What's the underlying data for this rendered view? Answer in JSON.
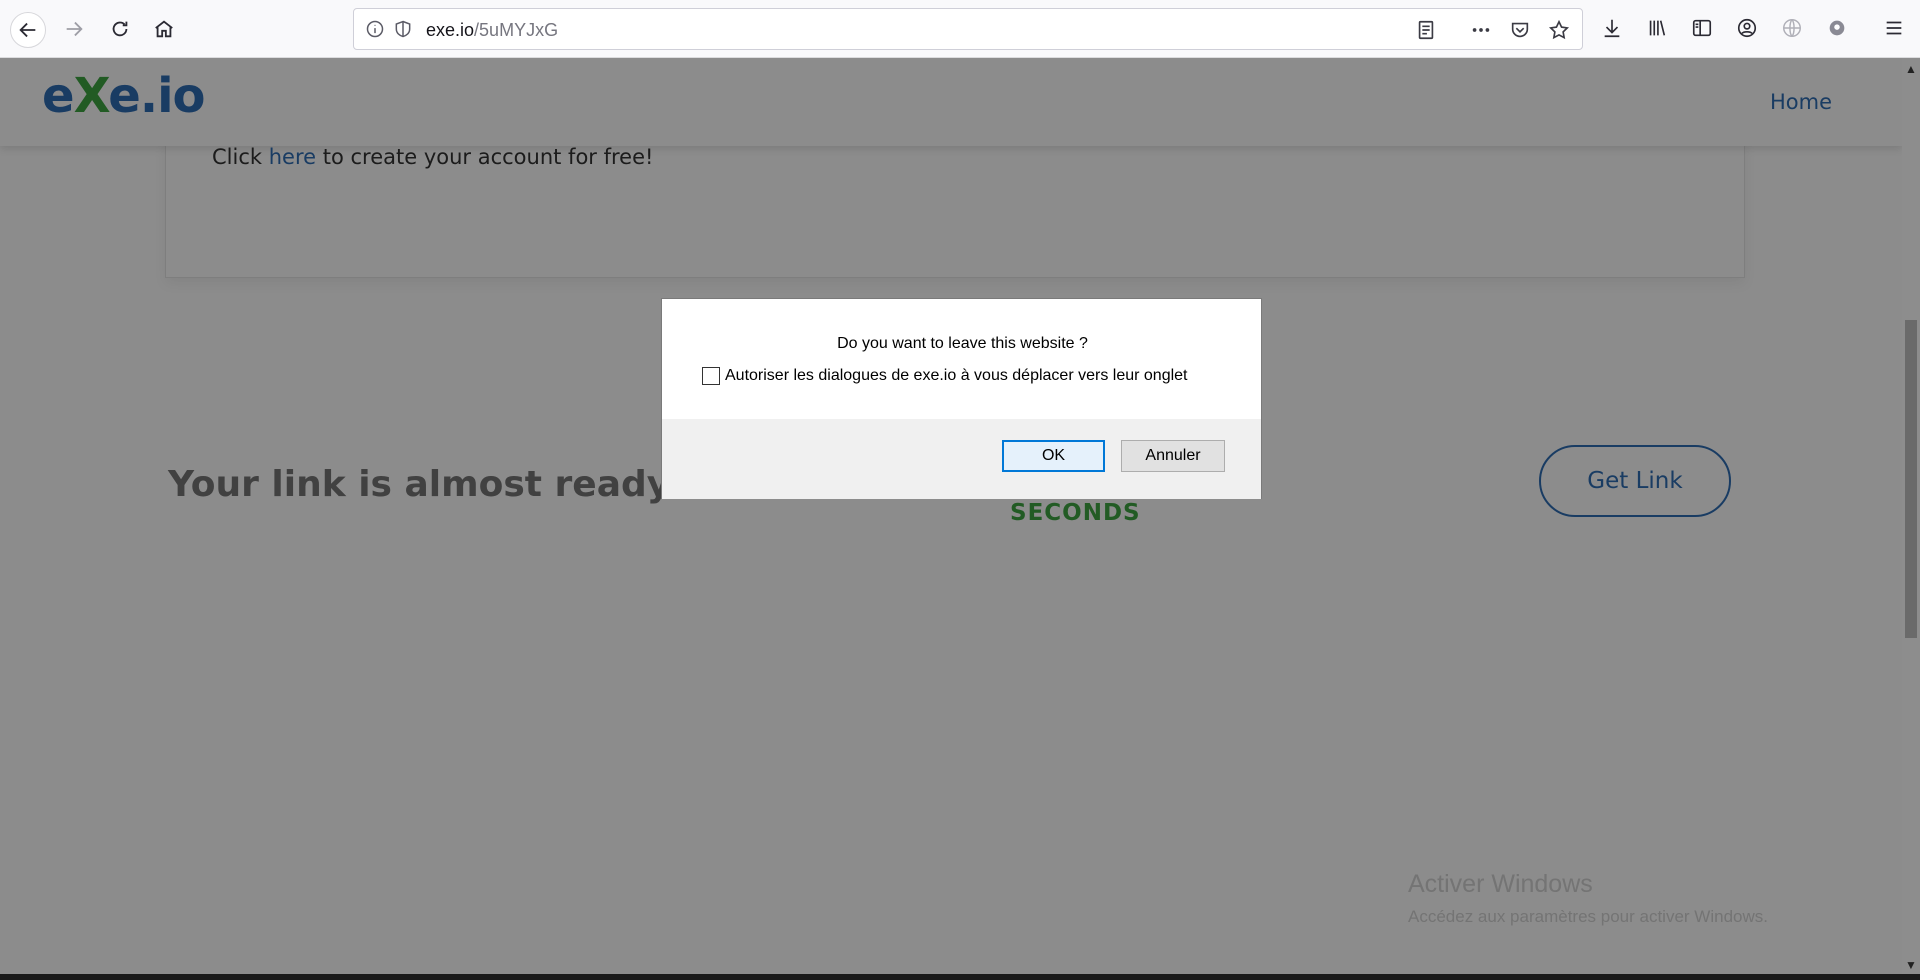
{
  "browser": {
    "url_host": "exe.io",
    "url_path": "/5uMYJxG"
  },
  "site": {
    "logo_prefix": "e",
    "logo_x": "X",
    "logo_suffix": "e.io",
    "nav_home": "Home",
    "promo_before": "Click ",
    "promo_link": "here",
    "promo_after": " to create your account for free!",
    "headline": "Your link is almost ready",
    "countdown_unit": "SECONDS",
    "get_link": "Get Link"
  },
  "dialog": {
    "message": "Do you want to leave this website ?",
    "checkbox_label": "Autoriser les dialogues de exe.io à vous déplacer vers leur onglet",
    "ok_label": "OK",
    "cancel_label": "Annuler"
  },
  "windows_watermark": {
    "title": "Activer Windows",
    "subtitle": "Accédez aux paramètres pour activer Windows."
  },
  "colors": {
    "brand_blue": "#2f6db4",
    "brand_green": "#3fa643",
    "dialog_accent": "#0078d7"
  }
}
